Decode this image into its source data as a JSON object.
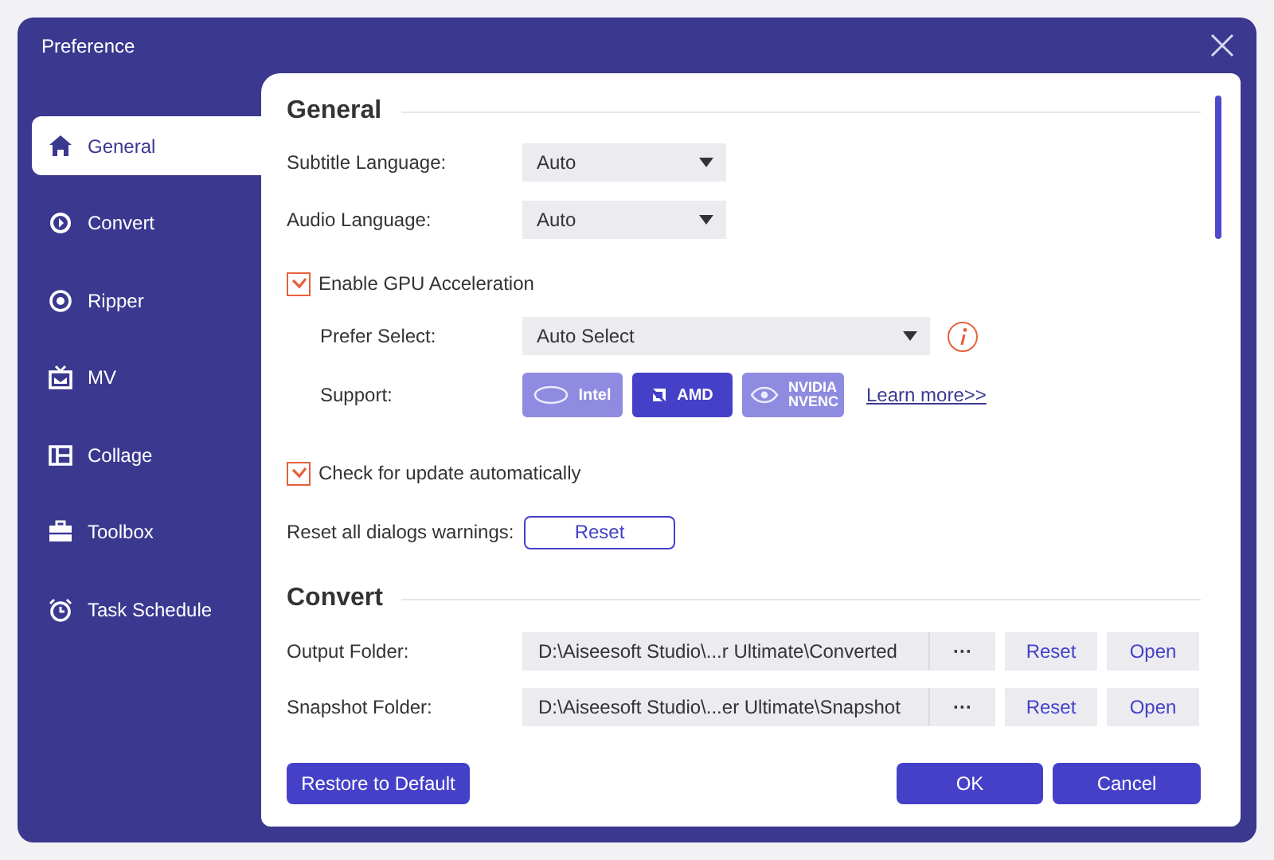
{
  "window": {
    "title": "Preference"
  },
  "sidebar": {
    "items": [
      {
        "label": "General",
        "kind": "home",
        "selected": true
      },
      {
        "label": "Convert",
        "kind": "convert",
        "selected": false
      },
      {
        "label": "Ripper",
        "kind": "ripper",
        "selected": false
      },
      {
        "label": "MV",
        "kind": "mv",
        "selected": false
      },
      {
        "label": "Collage",
        "kind": "collage",
        "selected": false
      },
      {
        "label": "Toolbox",
        "kind": "toolbox",
        "selected": false
      },
      {
        "label": "Task Schedule",
        "kind": "clock",
        "selected": false
      }
    ]
  },
  "general": {
    "heading": "General",
    "subtitle_language": {
      "label": "Subtitle Language:",
      "value": "Auto"
    },
    "audio_language": {
      "label": "Audio Language:",
      "value": "Auto"
    },
    "gpu": {
      "label": "Enable GPU Acceleration",
      "checked": true
    },
    "prefer_select": {
      "label": "Prefer Select:",
      "value": "Auto Select"
    },
    "support": {
      "label": "Support:",
      "options": [
        {
          "label": "Intel",
          "kind": "intel",
          "selected": false
        },
        {
          "label": "AMD",
          "kind": "amd",
          "selected": true
        },
        {
          "label": "NVIDIA NVENC",
          "kind": "nvidia",
          "selected": false
        }
      ],
      "link": "Learn more>>"
    },
    "check_update": {
      "label": "Check for update automatically",
      "checked": true
    },
    "reset_dialogs": {
      "label": "Reset all dialogs warnings:",
      "button": "Reset"
    }
  },
  "convert": {
    "heading": "Convert",
    "folders": [
      {
        "label": "Output Folder:",
        "path": "D:\\Aiseesoft Studio\\...r Ultimate\\Converted",
        "browse": "···",
        "reset": "Reset",
        "open": "Open"
      },
      {
        "label": "Snapshot Folder:",
        "path": "D:\\Aiseesoft Studio\\...er Ultimate\\Snapshot",
        "browse": "···",
        "reset": "Reset",
        "open": "Open"
      }
    ]
  },
  "buttons": {
    "restore": "Restore to Default",
    "ok": "OK",
    "cancel": "Cancel"
  }
}
